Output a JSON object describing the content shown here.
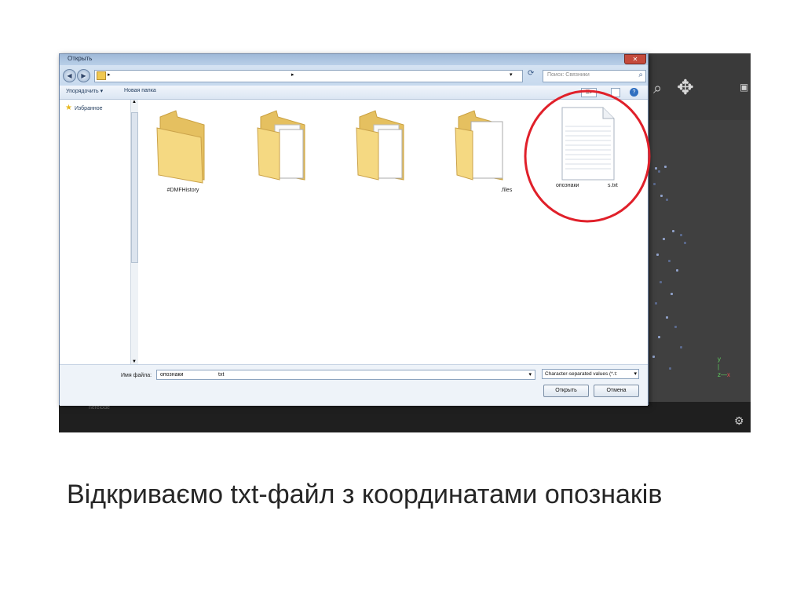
{
  "dialog": {
    "title": "Открыть",
    "close_glyph": "✕",
    "address_path": "",
    "search_placeholder": "Поиск: Связники",
    "toolbar": {
      "organize": "Упорядочить ▾",
      "new_folder": "Новая папка"
    },
    "nav": {
      "favorites": "Избранное"
    },
    "items": [
      {
        "label": "#DMFHistory",
        "type": "folder"
      },
      {
        "label": "",
        "type": "folder"
      },
      {
        "label": "",
        "type": "folder"
      },
      {
        "label": ".files",
        "type": "folder"
      },
      {
        "label_left": "опознаки",
        "label_right": "s.txt",
        "type": "file",
        "highlighted": true
      }
    ],
    "filename_label": "Имя файла:",
    "filename_value_a": "опознаки",
    "filename_value_b": "txt",
    "filetype_value": "Character-separated values (*.t:",
    "open_label": "Открыть",
    "cancel_label": "Отмена"
  },
  "app": {
    "status_text": "nefelode"
  },
  "caption": "Відкриваємо txt-файл з координатами опознаків",
  "colors": {
    "highlight_circle": "#e0202a",
    "folder_yellow": "#f0d27a",
    "dialog_bg": "#dfe8f3"
  }
}
